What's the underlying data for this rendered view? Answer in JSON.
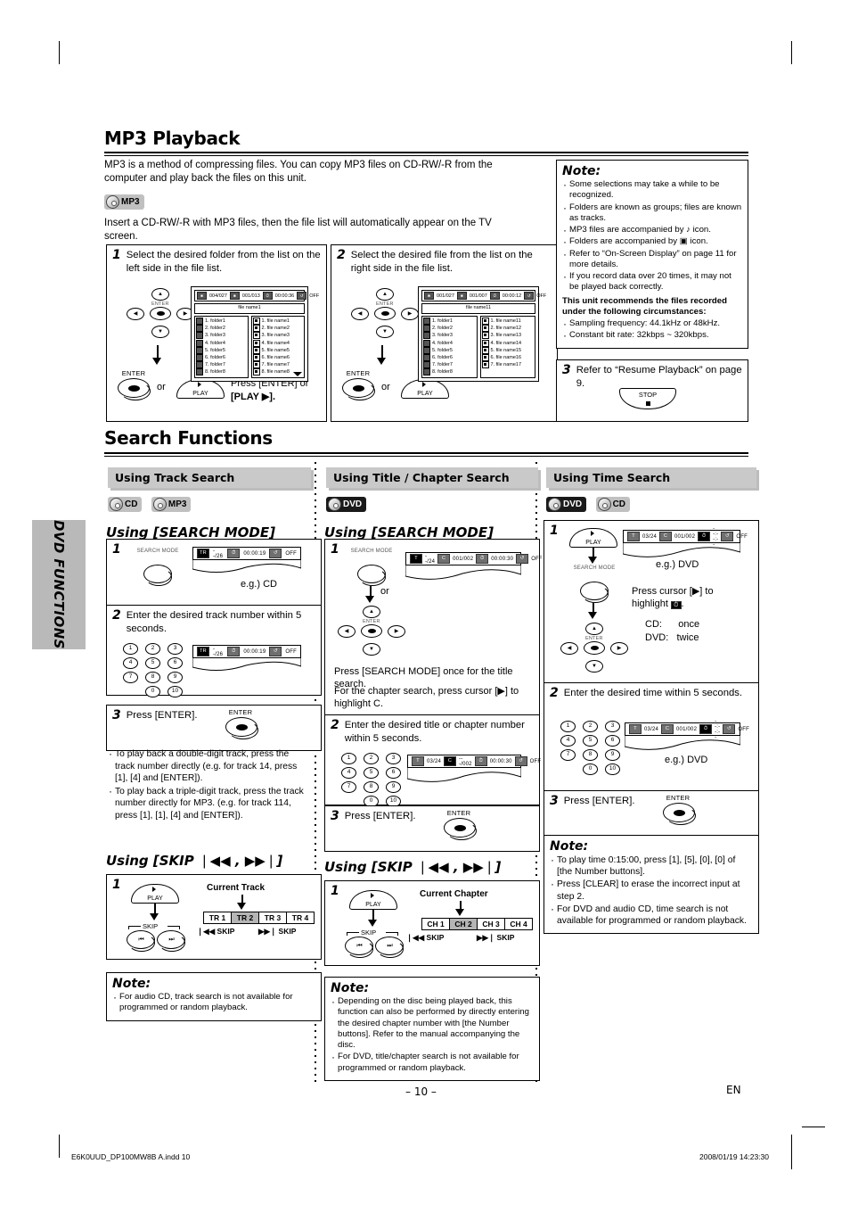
{
  "page": {
    "number": "– 10 –",
    "language": "EN",
    "side_tab": "DVD FUNCTIONS",
    "footer_left": "E6K0UUD_DP100MW8B A.indd   10",
    "footer_right": "2008/01/19   14:23:30"
  },
  "mp3": {
    "title": "MP3 Playback",
    "intro": "MP3 is a method of compressing files. You can copy MP3 files on CD-RW/-R from the computer and play back the files on this unit.",
    "badge": "MP3",
    "insert_line": "Insert a CD-RW/-R with MP3 files, then the file list will automatically appear on the TV screen.",
    "step1": {
      "num": "1",
      "text": "Select the desired folder from the list on the left side in the file list.",
      "enter_label": "ENTER",
      "or_label": "or",
      "play_label": "PLAY",
      "instruction_a": "Press [ENTER] or",
      "instruction_b": "[PLAY ▶]."
    },
    "step2": {
      "num": "2",
      "text": "Select the desired file from the list on the right side in the file list.",
      "enter_label": "ENTER",
      "or_label": "or",
      "play_label": "PLAY"
    },
    "step3": {
      "num": "3",
      "text": "Refer to “Resume Playback” on page 9.",
      "stop_label": "STOP"
    },
    "tv1": {
      "osd": [
        "004/027",
        "001/013",
        "00:00:36",
        "OFF"
      ],
      "title": "file name1",
      "folders": [
        "1. folder1",
        "2. folder2",
        "3. folder3",
        "4. folder4",
        "5. folder5",
        "6. folder6",
        "7. folder7",
        "8. folder8"
      ],
      "files": [
        "1. file name1",
        "2. file name2",
        "3. file name3",
        "4. file name4",
        "5. file name5",
        "6. file name6",
        "7. file name7",
        "8. file name8"
      ]
    },
    "tv2": {
      "osd": [
        "001/027",
        "001/007",
        "00:00:12",
        "OFF"
      ],
      "title": "file name11",
      "folders": [
        "1. folder1",
        "2. folder2",
        "3. folder3",
        "4. folder4",
        "5. folder5",
        "6. folder6",
        "7. folder7",
        "8. folder8"
      ],
      "files": [
        "1. file name11",
        "2. file name12",
        "3. file name13",
        "4. file name14",
        "5. file name15",
        "6. file name16",
        "7. file name17"
      ]
    },
    "note": {
      "title": "Note:",
      "items": [
        "Some selections may take a while to be recognized.",
        "Folders are known as groups; files are known as tracks.",
        "MP3 files are accompanied by ♪ icon.",
        "Folders are accompanied by ▣ icon.",
        "Refer to “On-Screen Display” on page 11 for more details.",
        "If you record data over 20 times, it may not be played back correctly."
      ],
      "bold_line": "This unit recommends the files recorded under the following circumstances:",
      "items2": [
        "Sampling frequency: 44.1kHz or 48kHz.",
        "Constant bit rate: 32kbps ~ 320kbps."
      ]
    }
  },
  "search": {
    "title": "Search Functions",
    "track": {
      "header": "Using Track Search",
      "badges": [
        "CD",
        "MP3"
      ],
      "searchmode_head": "Using [SEARCH MODE]",
      "skip_head": "Using [SKIP ❘◀◀ , ▶▶❘]",
      "step1": {
        "num": "1",
        "button_label": "SEARCH MODE",
        "osd": [
          "TR",
          "--/26",
          "00:00:19",
          "OFF"
        ],
        "example": "e.g.) CD"
      },
      "step2": {
        "num": "2",
        "text": "Enter the desired track number within 5 seconds.",
        "osd": [
          "TR",
          "--/26",
          "00:00:19",
          "OFF"
        ]
      },
      "step3": {
        "num": "3",
        "text": "Press [ENTER].",
        "enter_label": "ENTER"
      },
      "bullets": [
        "To play back a double-digit track, press the track number directly (e.g. for track 14, press [1], [4] and [ENTER]).",
        "To play back a triple-digit track, press the track number directly for MP3. (e.g. for track 114, press [1], [1], [4] and [ENTER])."
      ],
      "skip_step1": {
        "num": "1",
        "play_label": "PLAY",
        "skip_label": "SKIP",
        "current_label": "Current Track",
        "cells": [
          "TR 1",
          "TR 2",
          "TR 3",
          "TR 4"
        ],
        "current_index": 1,
        "skip_back": "❘◀◀ SKIP",
        "skip_fwd": "▶▶❘ SKIP"
      },
      "note": {
        "title": "Note:",
        "items": [
          "For audio CD, track search is not available for programmed or random playback."
        ]
      }
    },
    "title_chapter": {
      "header": "Using Title / Chapter Search",
      "badges": [
        "DVD"
      ],
      "searchmode_head": "Using [SEARCH MODE]",
      "skip_head": "Using [SKIP ❘◀◀ , ▶▶❘]",
      "step1": {
        "num": "1",
        "button_label": "SEARCH MODE",
        "or_label": "or",
        "osd": [
          "T",
          "--/24",
          "001/002",
          "00:00:30",
          "OFF"
        ],
        "text_a": "Press [SEARCH MODE] once for the title search.",
        "text_b": "For the chapter search, press cursor [▶] to highlight C."
      },
      "step2": {
        "num": "2",
        "text": "Enter the desired title or chapter number within 5 seconds.",
        "osd": [
          "T",
          "03/24",
          "---/002",
          "00:00:30",
          "OFF"
        ]
      },
      "step3": {
        "num": "3",
        "text": "Press [ENTER].",
        "enter_label": "ENTER"
      },
      "skip_step1": {
        "num": "1",
        "play_label": "PLAY",
        "skip_label": "SKIP",
        "current_label": "Current Chapter",
        "cells": [
          "CH 1",
          "CH 2",
          "CH 3",
          "CH 4"
        ],
        "current_index": 1,
        "skip_back": "❘◀◀ SKIP",
        "skip_fwd": "▶▶❘ SKIP"
      },
      "note": {
        "title": "Note:",
        "items": [
          "Depending on the disc being played back, this function can also be performed by directly entering the desired chapter number with [the Number buttons]. Refer to the manual accompanying the disc.",
          "For DVD, title/chapter search is not available for programmed or random playback."
        ]
      }
    },
    "time": {
      "header": "Using Time Search",
      "badges": [
        "DVD",
        "CD"
      ],
      "step1": {
        "num": "1",
        "play_label": "PLAY",
        "button_label": "SEARCH MODE",
        "osd": [
          "T",
          "03/24",
          "001/002",
          "--:--:--",
          "OFF"
        ],
        "example": "e.g.) DVD",
        "text_a": "Press cursor [▶] to highlight",
        "cd_line": "CD:      once",
        "dvd_line": "DVD:   twice"
      },
      "step2": {
        "num": "2",
        "text": "Enter the desired time within 5 seconds.",
        "osd": [
          "T",
          "03/24",
          "001/002",
          "--:--:--",
          "OFF"
        ],
        "example": "e.g.) DVD"
      },
      "step3": {
        "num": "3",
        "text": "Press [ENTER].",
        "enter_label": "ENTER"
      },
      "note": {
        "title": "Note:",
        "items": [
          "To play time 0:15:00, press [1], [5], [0], [0] of [the Number buttons].",
          "Press [CLEAR] to erase the incorrect input at step 2.",
          "For DVD and audio CD, time search is not available for programmed or random playback."
        ]
      }
    }
  },
  "keypad": [
    "1",
    "2",
    "3",
    "4",
    "5",
    "6",
    "7",
    "8",
    "9",
    "0",
    "10"
  ]
}
